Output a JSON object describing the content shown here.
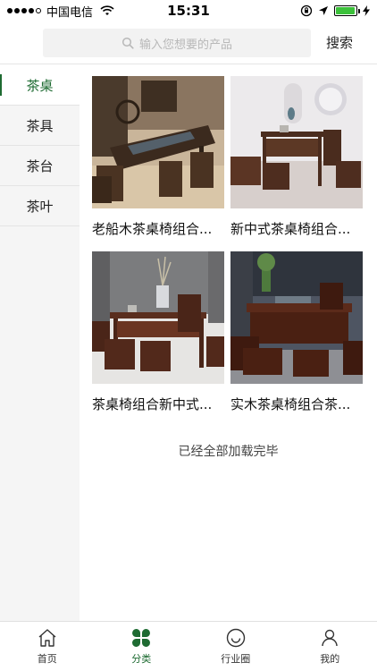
{
  "status_bar": {
    "carrier": "中国电信",
    "time": "15:31",
    "battery_level": 0.95,
    "battery_color": "#3cc13b"
  },
  "header": {
    "search_placeholder": "输入您想要的产品",
    "search_button": "搜索"
  },
  "sidebar": {
    "items": [
      {
        "label": "茶桌",
        "active": true
      },
      {
        "label": "茶具",
        "active": false
      },
      {
        "label": "茶台",
        "active": false
      },
      {
        "label": "茶叶",
        "active": false
      }
    ]
  },
  "products": [
    {
      "title": "老船木茶桌椅组合..."
    },
    {
      "title": "新中式茶桌椅组合..."
    },
    {
      "title": "茶桌椅组合新中式..."
    },
    {
      "title": "实木茶桌椅组合茶..."
    }
  ],
  "list_end_text": "已经全部加载完毕",
  "tabbar": {
    "items": [
      {
        "label": "首页",
        "icon": "home-icon",
        "active": false
      },
      {
        "label": "分类",
        "icon": "category-icon",
        "active": true
      },
      {
        "label": "行业圈",
        "icon": "smile-icon",
        "active": false
      },
      {
        "label": "我的",
        "icon": "user-icon",
        "active": false
      }
    ]
  },
  "colors": {
    "accent": "#1e6b32",
    "sidebar_bg": "#f5f5f5",
    "search_bg": "#f2f2f2"
  }
}
